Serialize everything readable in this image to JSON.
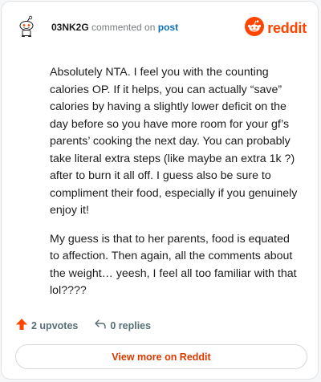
{
  "header": {
    "username": "03NK2G",
    "action_text": "commented on",
    "post_link": "post",
    "brand": "reddit"
  },
  "comment": {
    "paragraphs": [
      "Absolutely NTA. I feel you with the counting calories OP. If it helps, you can actually “save” calories by having a slightly lower deficit on the day before so you have more room for your gf’s parents’ cooking the next day. You can probably take literal extra steps (like maybe an extra 1k ?) after to burn it all off. I guess also be sure to compliment their food, especially if you genuinely enjoy it!",
      "My guess is that to her parents, food is equated to affection. Then again, all the comments about the weight… yeesh, I feel all too familiar with that lol????"
    ]
  },
  "stats": {
    "upvotes": "2 upvotes",
    "replies": "0 replies"
  },
  "footer": {
    "view_more": "View more on Reddit"
  },
  "colors": {
    "brand": "#ff4500",
    "link": "#0a6fba",
    "view_more": "#d93a00"
  },
  "icons": {
    "avatar": "snoo-avatar-icon",
    "logo": "reddit-snoo-icon",
    "upvote": "upvote-arrow-icon",
    "reply": "reply-arrow-icon"
  }
}
